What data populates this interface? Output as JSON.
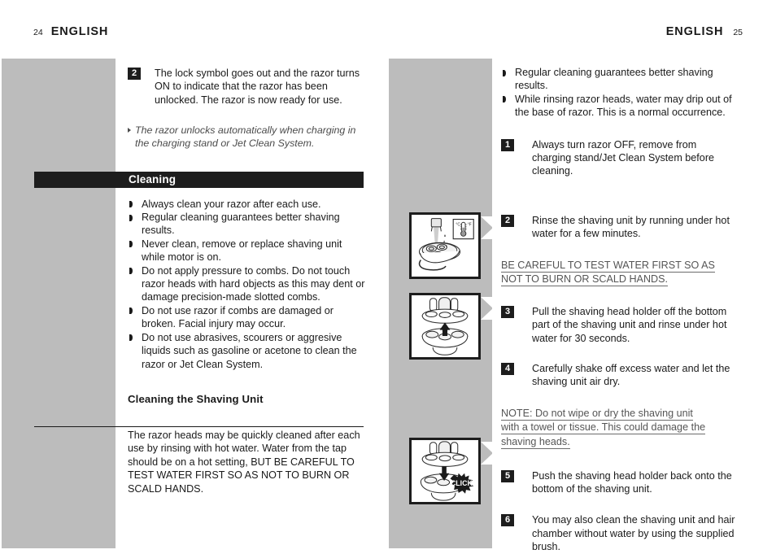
{
  "document": {
    "left_page": {
      "header_title": "ENGLISH",
      "folio": "24"
    },
    "right_page": {
      "header_title": "ENGLISH",
      "folio": "25"
    }
  },
  "left_column": {
    "step_2": {
      "number": "2",
      "text": "The lock symbol goes out and the razor turns ON to indicate that the razor has been unlocked. The razor is now ready for use."
    },
    "italic_note": "The razor unlocks automatically when charging in the charging stand or Jet Clean System.",
    "section_heading": "Cleaning",
    "cleaning_bullets": [
      "Always clean your razor after each use.",
      "Regular cleaning guarantees better shaving results.",
      "Never clean, remove or replace shaving unit while motor is on.",
      "Do not apply pressure to combs.  Do not touch razor heads with hard objects as this may dent or damage precision-made slotted combs.",
      "Do not use razor if combs are damaged or broken. Facial injury may occur.",
      "Do not use abrasives, scourers or aggresive liquids such as gasoline or acetone to clean the razor or Jet Clean System."
    ],
    "sub_heading": "Cleaning the Shaving Unit",
    "body_paragraph": "The razor heads may be quickly cleaned after each use by rinsing with hot water. Water from the tap should be on a hot setting, BUT BE CAREFUL TO TEST WATER FIRST SO AS NOT TO BURN OR SCALD HANDS."
  },
  "right_column": {
    "bullets": [
      "Regular cleaning guarantees better shaving results.",
      "While rinsing razor heads, water may drip out of the base of razor. This is a normal occurrence."
    ],
    "steps": [
      {
        "number": "1",
        "text": "Always turn razor OFF, remove from charging stand/Jet Clean System before cleaning."
      },
      {
        "number": "2",
        "text": "Rinse the shaving unit by running under hot water for a few minutes."
      },
      {
        "number": "3",
        "text": "Pull the shaving head holder off the bottom part of the shaving unit and rinse under hot water for 30 seconds."
      },
      {
        "number": "4",
        "text": "Carefully shake off excess water and let the shaving unit air dry."
      },
      {
        "number": "5",
        "text": "Push the shaving head holder back onto the bottom of the shaving unit."
      },
      {
        "number": "6",
        "text": "You may also clean the shaving unit and hair chamber without water by using the supplied brush."
      }
    ],
    "caution_line_1": "BE CAREFUL TO TEST WATER FIRST SO AS ",
    "caution_line_2": "NOT TO BURN OR SCALD HANDS. ",
    "note_line_1": "NOTE: Do not wipe or dry the shaving unit ",
    "note_line_2": "with a towel or tissue. This could damage the ",
    "note_line_3": "shaving heads."
  },
  "figures": {
    "figure_1": {
      "caption_hint": "rinse-shaving-unit-under-running-water",
      "thermometer_celsius": "°C",
      "thermometer_fahrenheit": "°F"
    },
    "figure_2": {
      "caption_hint": "pull-shaving-head-holder-off"
    },
    "figure_3": {
      "caption_hint": "push-shaving-head-holder-back-click",
      "click_label": "CLICK"
    }
  },
  "colors": {
    "panel_gray": "#bcbcbc",
    "bar_black": "#1d1d1d",
    "text_black": "#1a1a1a",
    "muted_gray": "#555555"
  }
}
